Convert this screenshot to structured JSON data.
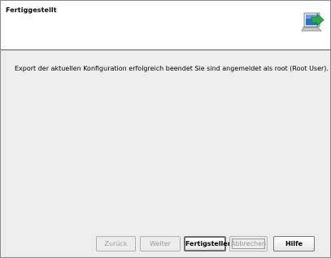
{
  "header": {
    "title": "Fertiggestellt",
    "icon": "wizard-export-icon"
  },
  "main": {
    "message": "Export der aktuellen Konfiguration erfolgreich beendet Sie sind angemeldet als root (Root User)."
  },
  "buttons": {
    "back": "Zurück",
    "next": "Weiter",
    "finish": "Fertigstellen",
    "cancel": "Abbrechen",
    "help": "Hilfe"
  },
  "colors": {
    "accent_arrow": "#2fa84a",
    "screen_blue": "#2f6fc4"
  }
}
